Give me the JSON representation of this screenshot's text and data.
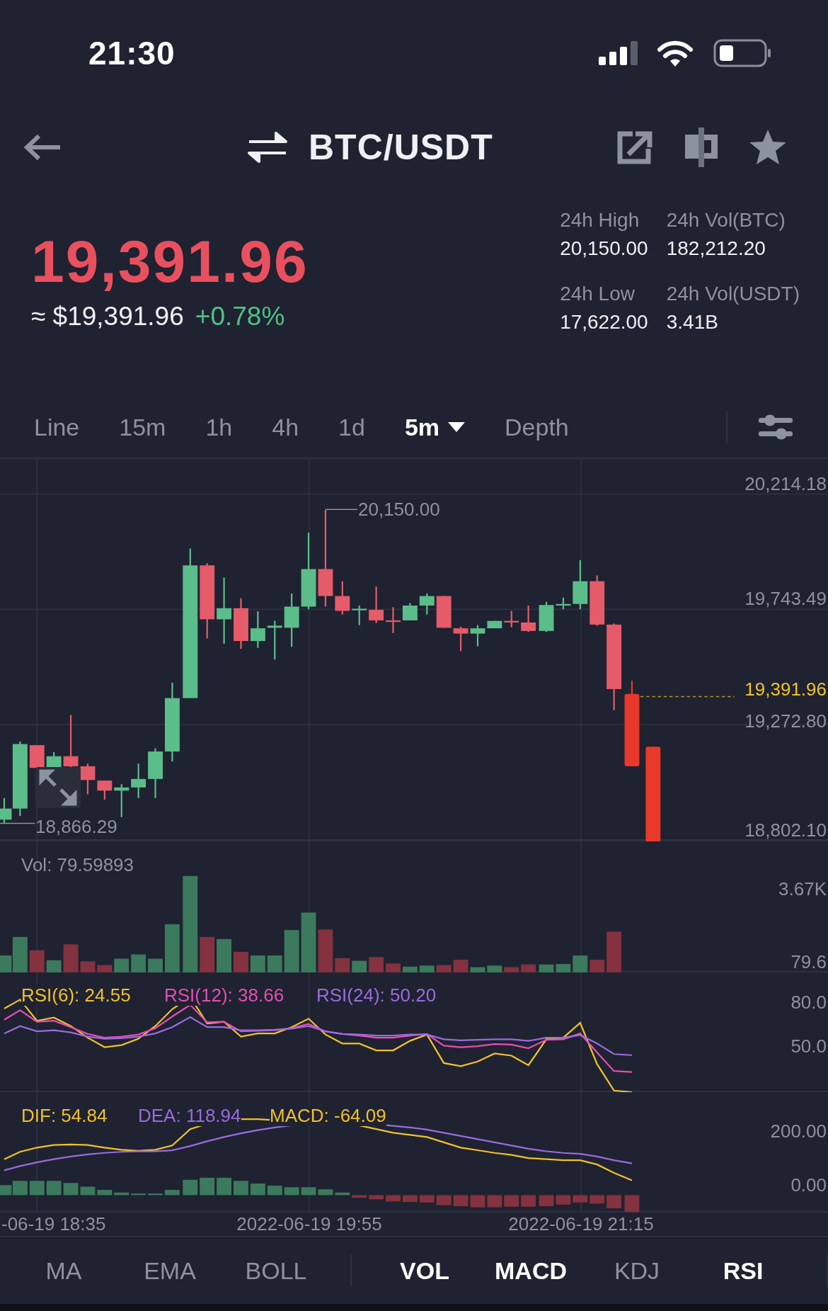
{
  "status_bar": {
    "time": "21:30"
  },
  "header": {
    "title": "BTC/USDT"
  },
  "price": {
    "last": "19,391.96",
    "fiat": "≈ $19,391.96",
    "change": "+0.78%"
  },
  "stats": [
    {
      "label": "24h High",
      "value": "20,150.00"
    },
    {
      "label": "24h Vol(BTC)",
      "value": "182,212.20"
    },
    {
      "label": "24h Low",
      "value": "17,622.00"
    },
    {
      "label": "24h Vol(USDT)",
      "value": "3.41B"
    }
  ],
  "intervals": [
    {
      "label": "Line",
      "selected": false,
      "has_menu": false
    },
    {
      "label": "15m",
      "selected": false,
      "has_menu": false
    },
    {
      "label": "1h",
      "selected": false,
      "has_menu": false
    },
    {
      "label": "4h",
      "selected": false,
      "has_menu": false
    },
    {
      "label": "1d",
      "selected": false,
      "has_menu": false
    },
    {
      "label": "5m",
      "selected": true,
      "has_menu": true
    },
    {
      "label": "Depth",
      "selected": false,
      "has_menu": false
    }
  ],
  "main_chart": {
    "price_labels": [
      "20,214.18",
      "19,743.49",
      "19,272.80",
      "18,802.10"
    ],
    "last_price_label": "19,391.96",
    "high_label": "20,150.00",
    "low_label": "18,866.29"
  },
  "volume": {
    "legend": "Vol: 79.59893",
    "axis_labels": [
      "3.67K",
      "79.6"
    ]
  },
  "rsi": {
    "legends": [
      {
        "text": "RSI(6): 24.55",
        "color": "#f0c12c"
      },
      {
        "text": "RSI(12): 38.66",
        "color": "#e24fb5"
      },
      {
        "text": "RSI(24): 50.20",
        "color": "#9a6be0"
      }
    ],
    "axis_labels": [
      "80.0",
      "50.0"
    ]
  },
  "macd": {
    "legends": [
      {
        "text": "DIF: 54.84",
        "color": "#f0c12c"
      },
      {
        "text": "DEA: 118.94",
        "color": "#9a6be0"
      },
      {
        "text": "MACD: -64.09",
        "color": "#f0c12c"
      }
    ],
    "axis_labels": [
      "200.00",
      "0.00"
    ]
  },
  "time_axis": [
    "-06-19 18:35",
    "2022-06-19 19:55",
    "2022-06-19 21:15"
  ],
  "indicators": [
    {
      "label": "MA",
      "selected": false,
      "separated": false
    },
    {
      "label": "EMA",
      "selected": false,
      "separated": false
    },
    {
      "label": "BOLL",
      "selected": false,
      "separated": false
    },
    {
      "label": "VOL",
      "selected": true,
      "separated": true
    },
    {
      "label": "MACD",
      "selected": true,
      "separated": false
    },
    {
      "label": "KDJ",
      "selected": false,
      "separated": false
    },
    {
      "label": "RSI",
      "selected": true,
      "separated": false
    }
  ]
}
